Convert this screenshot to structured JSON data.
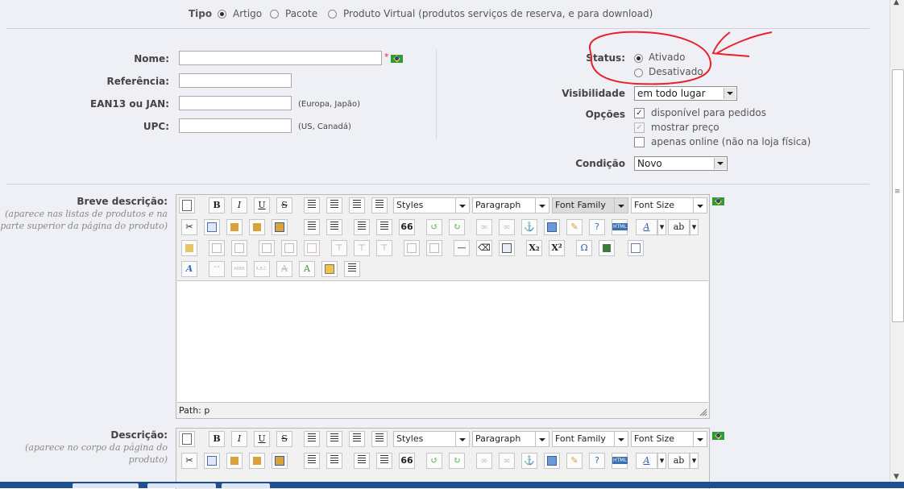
{
  "tipo": {
    "label": "Tipo",
    "options": [
      {
        "label": "Artigo",
        "selected": true
      },
      {
        "label": "Pacote",
        "selected": false
      },
      {
        "label": "Produto Virtual (produtos serviços de reserva, e para download)",
        "selected": false
      }
    ]
  },
  "fields": {
    "nome": {
      "label": "Nome:",
      "value": "",
      "required_mark": "*"
    },
    "referencia": {
      "label": "Referência:",
      "value": ""
    },
    "ean13": {
      "label": "EAN13 ou JAN:",
      "value": "",
      "hint": "(Europa, Japão)"
    },
    "upc": {
      "label": "UPC:",
      "value": "",
      "hint": "(US, Canadá)"
    }
  },
  "status": {
    "label": "Status:",
    "options": [
      {
        "label": "Ativado",
        "selected": true
      },
      {
        "label": "Desativado",
        "selected": false
      }
    ]
  },
  "visibilidade": {
    "label": "Visibilidade",
    "value": "em todo lugar"
  },
  "opcoes": {
    "label": "Opções",
    "items": [
      {
        "label": "disponível para pedidos",
        "checked": true,
        "disabled": false
      },
      {
        "label": "mostrar preço",
        "checked": true,
        "disabled": true
      },
      {
        "label": "apenas online (não na loja física)",
        "checked": false,
        "disabled": false
      }
    ]
  },
  "condicao": {
    "label": "Condição",
    "value": "Novo"
  },
  "editor_short": {
    "label": "Breve descrição:",
    "sublabel": "(aparece nas listas de produtos e na parte superior da página do produto)",
    "path": "Path: p"
  },
  "editor_long": {
    "label": "Descrição:",
    "sublabel": "(aparece no corpo da página do produto)"
  },
  "toolbar": {
    "bold": "B",
    "italic": "I",
    "underline": "U",
    "strike": "S",
    "blockquote": "66",
    "subscript": "X₂",
    "superscript": "X²",
    "omega": "Ω",
    "forecolor": "A",
    "backcolor": "ab",
    "styles": "Styles",
    "paragraph": "Paragraph",
    "font_family": "Font Family",
    "font_size": "Font Size",
    "html": "HTML",
    "cite": "“”",
    "abbr": "ABBR",
    "acronym": "A.B.C."
  },
  "colors": {
    "annotation": "#e8222a",
    "background": "#eef0f6"
  }
}
